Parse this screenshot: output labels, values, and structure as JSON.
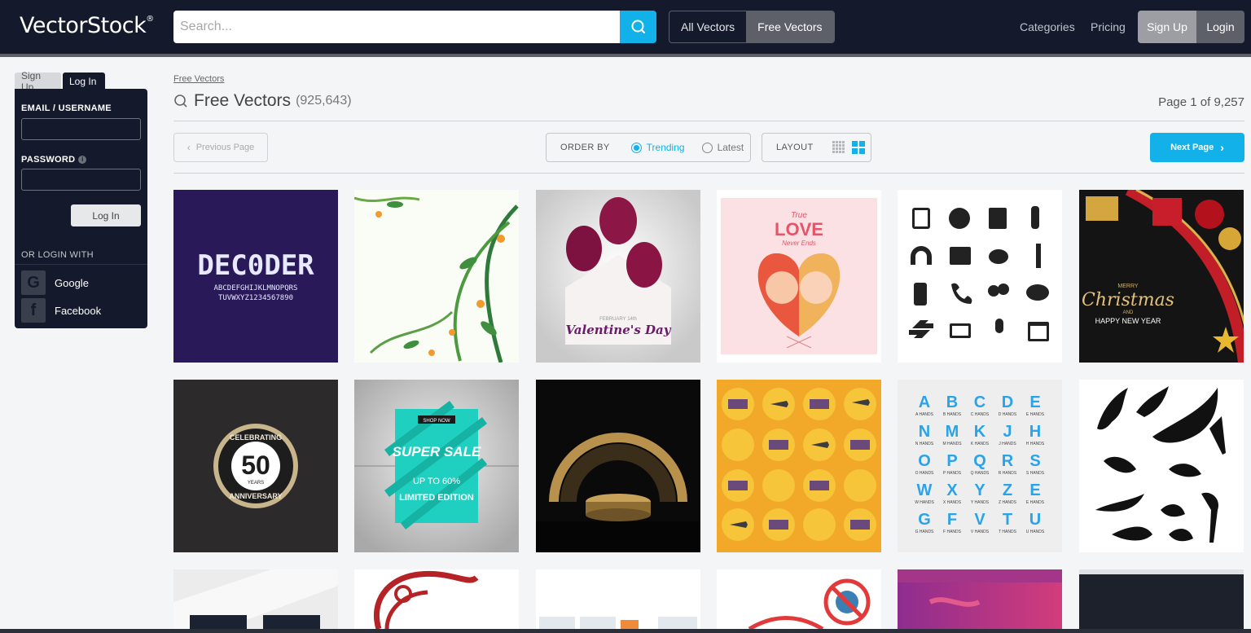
{
  "header": {
    "logo": "VectorStock",
    "logo_mark": "®",
    "search_placeholder": "Search...",
    "toggle": [
      "All Vectors",
      "Free Vectors"
    ],
    "nav": [
      "Categories",
      "Pricing"
    ],
    "signup": "Sign Up",
    "login": "Login",
    "accent": "#12b1e9"
  },
  "sidebar": {
    "tabs": [
      "Sign Up",
      "Log In"
    ],
    "email_label": "EMAIL / USERNAME",
    "password_label": "PASSWORD",
    "login_button": "Log In",
    "or_login_with": "OR LOGIN WITH",
    "social": [
      "Google",
      "Facebook"
    ]
  },
  "main": {
    "breadcrumb": "Free Vectors",
    "title": "Free Vectors",
    "count": "(925,643)",
    "page_info": "Page 1 of 9,257",
    "prev": "Previous Page",
    "order_by": "ORDER BY",
    "order_options": [
      "Trending",
      "Latest"
    ],
    "order_selected": "Trending",
    "layout": "LAYOUT",
    "next": "Next Page"
  },
  "thumbs": {
    "decoder": {
      "title": "DEC0DER",
      "sub1": "ABCDEFGHIJKLMNOPQRS",
      "sub2": "TUVWXYZ1234567890"
    },
    "valentine": {
      "date": "FEBRUARY 14th",
      "text": "Valentine's Day"
    },
    "love": {
      "top": "True",
      "word": "LOVE",
      "sub": "Never Ends"
    },
    "christmas": {
      "merry": "MERRY",
      "word": "Christmas",
      "and": "AND",
      "ny": "HAPPY NEW YEAR"
    },
    "anniv": {
      "top": "CELEBRATING",
      "num": "50",
      "years": "YEARS",
      "bottom": "ANNIVERSARY"
    },
    "sale": {
      "shop": "SHOP NOW",
      "super": "SUPER SALE",
      "upto": "UP TO 60%",
      "limited": "LIMITED EDITION"
    },
    "alphabet": {
      "letters": [
        "A",
        "B",
        "C",
        "D",
        "E",
        "N",
        "M",
        "K",
        "J",
        "H",
        "O",
        "P",
        "Q",
        "R",
        "S",
        "W",
        "X",
        "Y",
        "Z",
        "E",
        "G",
        "F",
        "V",
        "T",
        "U"
      ],
      "caption": "HANDS"
    }
  }
}
